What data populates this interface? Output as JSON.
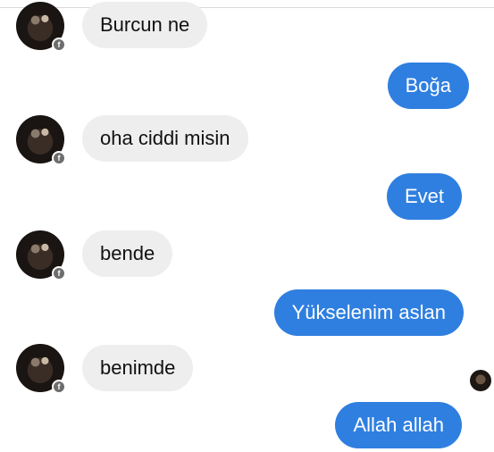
{
  "messages": [
    {
      "side": "in",
      "text": "Burcun ne"
    },
    {
      "side": "out",
      "text": "Boğa"
    },
    {
      "side": "in",
      "text": "oha ciddi misin"
    },
    {
      "side": "out",
      "text": "Evet"
    },
    {
      "side": "in",
      "text": "bende"
    },
    {
      "side": "out",
      "text": "Yükselenim aslan"
    },
    {
      "side": "in",
      "text": "benimde"
    },
    {
      "side": "out",
      "text": "Allah allah"
    }
  ],
  "colors": {
    "incoming_bubble": "#eeeeef",
    "outgoing_bubble": "#2f7fe0",
    "incoming_text": "#111111",
    "outgoing_text": "#ffffff"
  },
  "icons": {
    "contact_avatar": "avatar-photo",
    "avatar_badge": "facebook-icon",
    "seen_indicator": "seen-avatar-icon"
  }
}
